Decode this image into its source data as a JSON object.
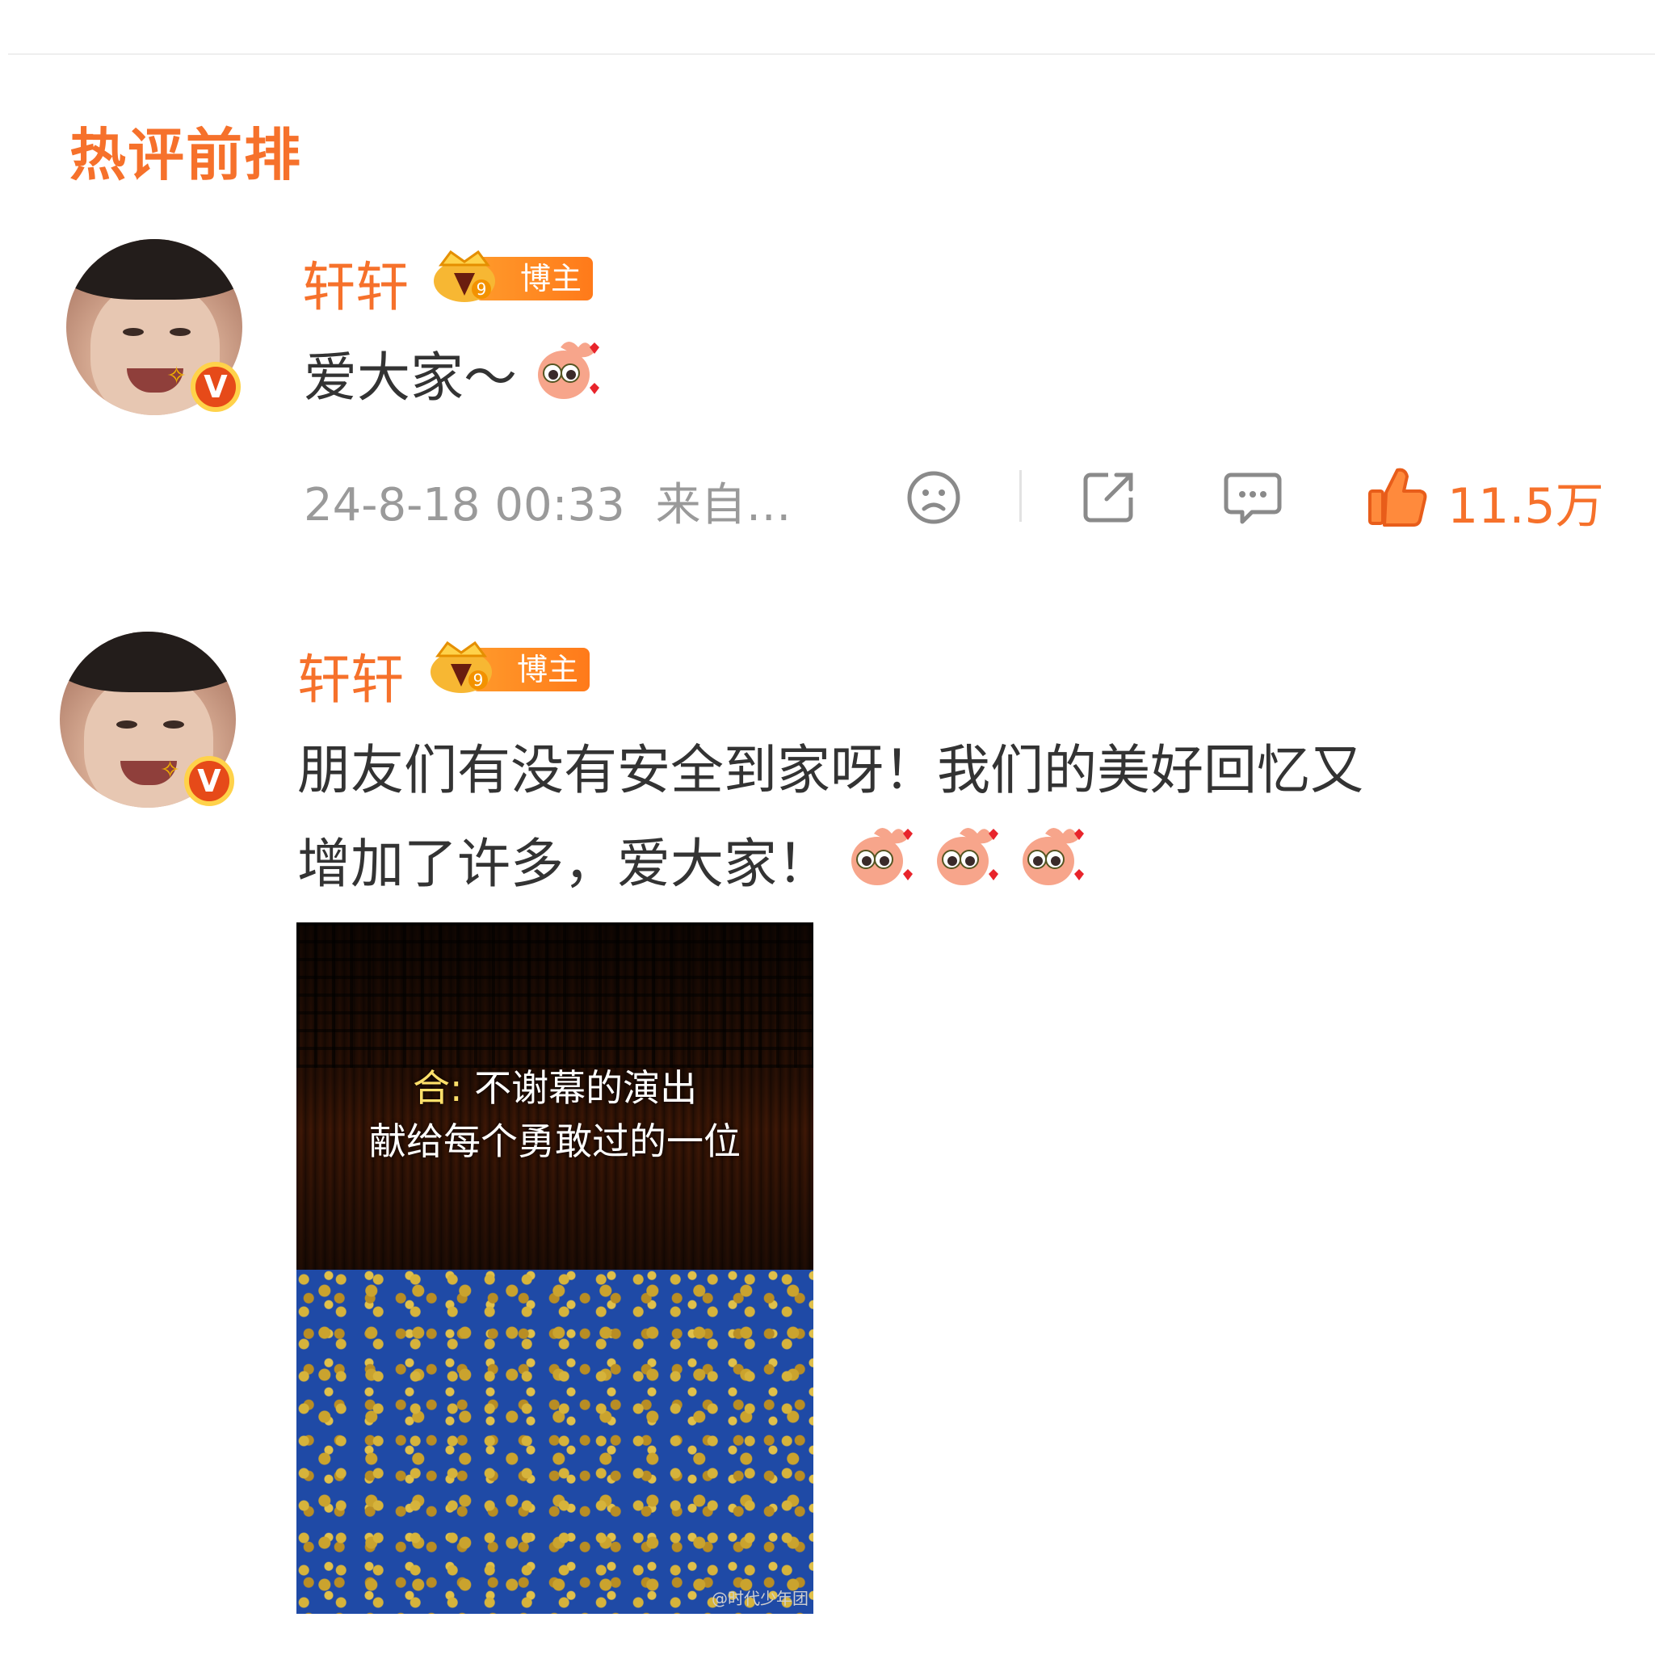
{
  "section": {
    "title": "热评前排"
  },
  "comments": [
    {
      "username": "轩轩",
      "badge_label": "博主",
      "badge_level": "9",
      "text": "爱大家～",
      "emoji": [
        "heart-eyes-emoji"
      ],
      "timestamp": "24-8-18 00:33",
      "source": "来自…",
      "like_count": "11.5万"
    },
    {
      "username": "轩轩",
      "badge_label": "博主",
      "badge_level": "9",
      "text_line1": "朋友们有没有安全到家呀！我们的美好回忆又",
      "text_line2": "增加了许多，爱大家！",
      "emoji": [
        "heart-eyes-emoji",
        "heart-eyes-emoji",
        "heart-eyes-emoji"
      ],
      "photo": {
        "caption_prefix": "合:",
        "caption_line1": "不谢幕的演出",
        "caption_line2": "献给每个勇敢过的一位",
        "watermark": "@时代少年团"
      }
    }
  ],
  "colors": {
    "accent": "#f6712b",
    "text": "#333333",
    "meta": "#9a9a9a"
  },
  "icons": [
    "dislike-face-icon",
    "share-icon",
    "comment-icon",
    "thumbs-up-icon"
  ]
}
